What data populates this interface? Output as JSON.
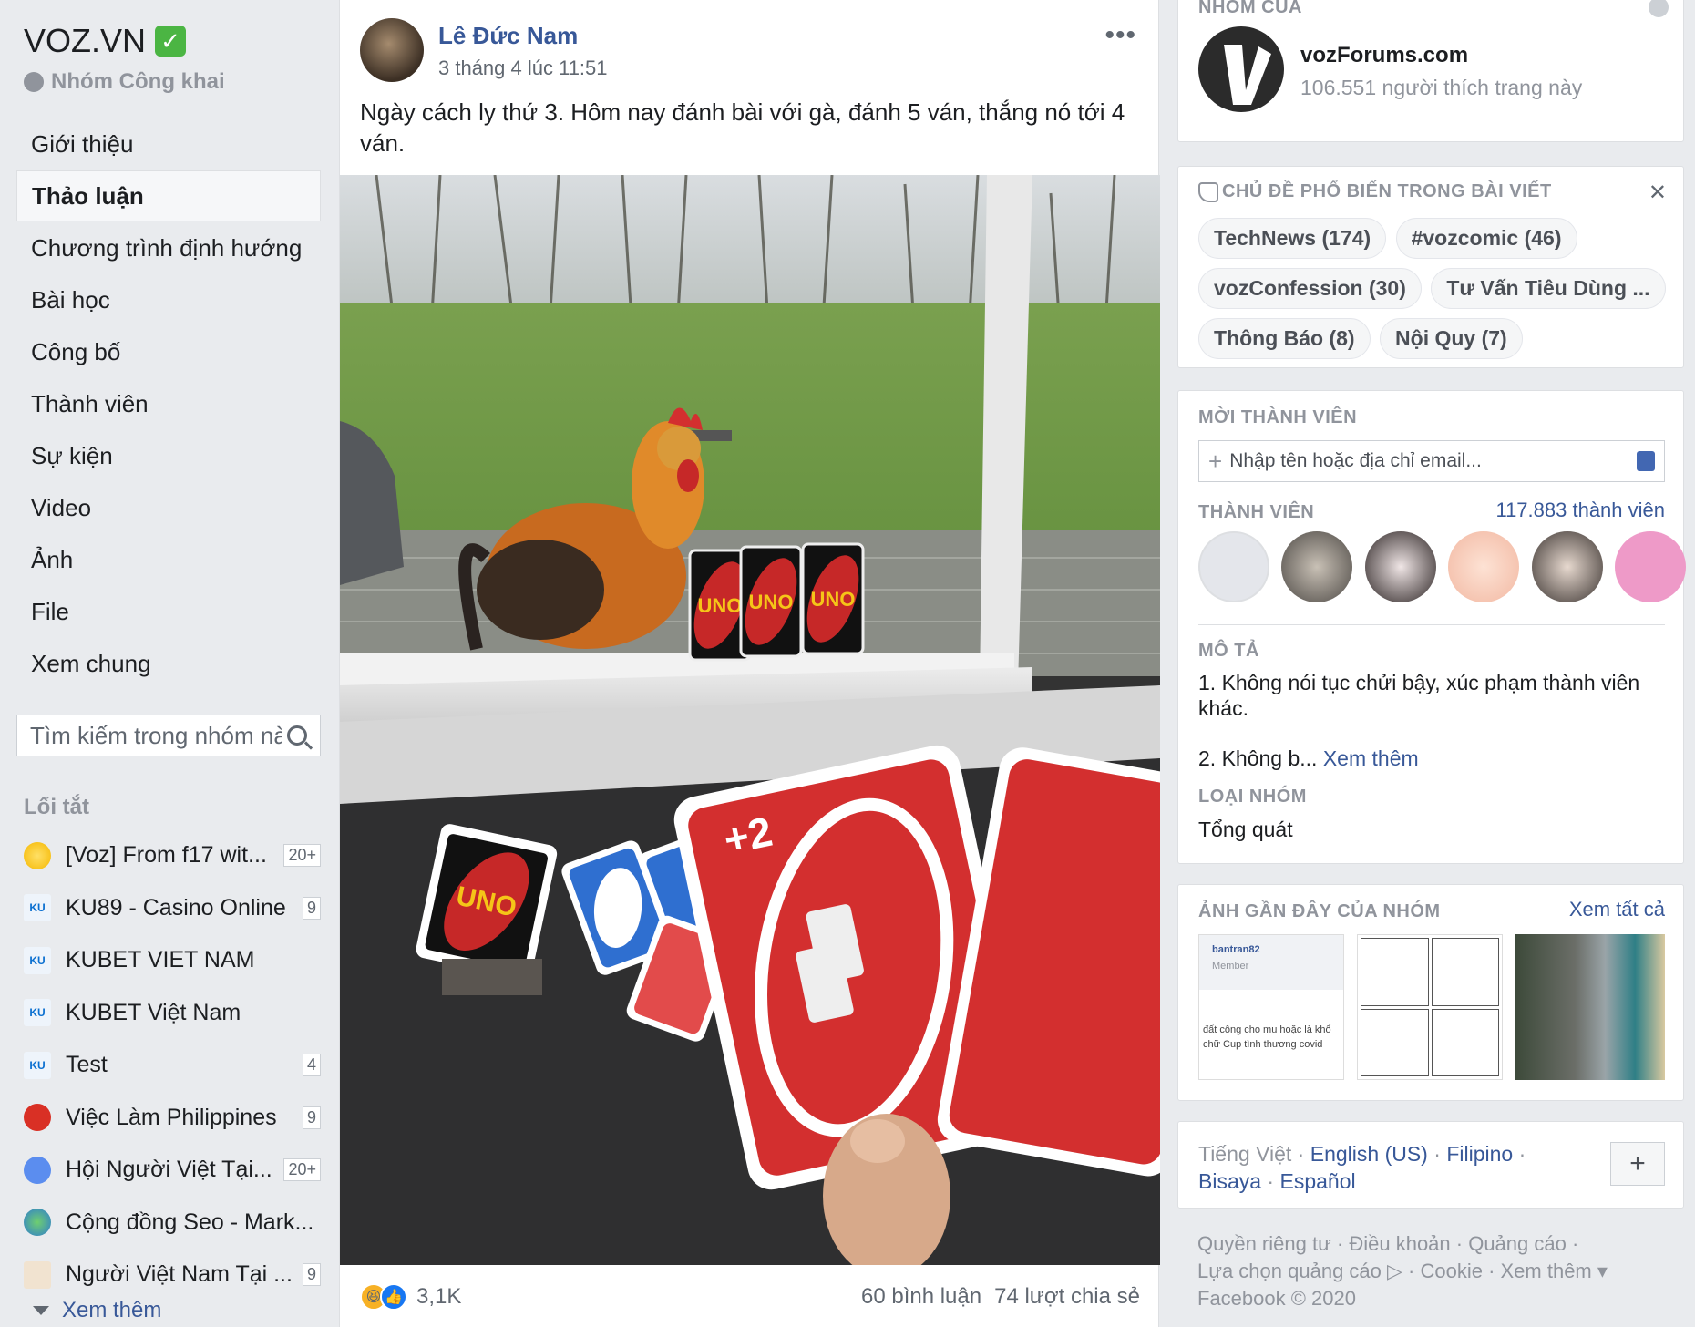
{
  "group": {
    "name": "VOZ.VN",
    "verified_mark": "✓",
    "type": "Nhóm Công khai"
  },
  "nav": [
    {
      "label": "Giới thiệu",
      "active": false
    },
    {
      "label": "Thảo luận",
      "active": true
    },
    {
      "label": "Chương trình định hướng",
      "active": false
    },
    {
      "label": "Bài học",
      "active": false
    },
    {
      "label": "Công bố",
      "active": false
    },
    {
      "label": "Thành viên",
      "active": false
    },
    {
      "label": "Sự kiện",
      "active": false
    },
    {
      "label": "Video",
      "active": false
    },
    {
      "label": "Ảnh",
      "active": false
    },
    {
      "label": "File",
      "active": false
    },
    {
      "label": "Xem chung",
      "active": false
    }
  ],
  "search": {
    "placeholder": "Tìm kiếm trong nhóm này"
  },
  "shortcuts": {
    "title": "Lối tắt",
    "items": [
      {
        "label": "[Voz] From f17 wit...",
        "badge": "20+",
        "icon": "sun-icon"
      },
      {
        "label": "KU89 - Casino Online",
        "badge": "9",
        "icon": "ku-logo-icon"
      },
      {
        "label": "KUBET VIET NAM",
        "badge": "",
        "icon": "ku-logo-icon"
      },
      {
        "label": "KUBET Việt Nam",
        "badge": "",
        "icon": "ku-logo-icon"
      },
      {
        "label": "Test",
        "badge": "4",
        "icon": "ku-logo-icon"
      },
      {
        "label": "Việc Làm Philippines",
        "badge": "9",
        "icon": "red-circle-icon"
      },
      {
        "label": "Hội Người Việt Tại...",
        "badge": "20+",
        "icon": "group-people-icon"
      },
      {
        "label": "Cộng đồng Seo - Mark...",
        "badge": "",
        "icon": "globe-icon"
      },
      {
        "label": "Người Việt Nam Tại ...",
        "badge": "9",
        "icon": "house-icon"
      }
    ],
    "see_more": "Xem thêm"
  },
  "post": {
    "author": "Lê Đức Nam",
    "time": "3 tháng 4 lúc 11:51",
    "more": "•••",
    "text": "Ngày cách ly thứ 3. Hôm nay đánh bài với gà, đánh 5 ván, thắng nó tới 4 ván.",
    "card_text": "UNO",
    "plus_two": "+2",
    "reactions_count": "3,1K",
    "comments": "60 bình luận",
    "shares": "74 lượt chia sẻ"
  },
  "page_card": {
    "heading": "NHÓM CỦA",
    "name": "vozForums.com",
    "likes": "106.551 người thích trang này"
  },
  "topics": {
    "title": "CHỦ ĐỀ PHỔ BIẾN TRONG BÀI VIẾT",
    "close": "✕",
    "items": [
      "TechNews (174)",
      "#vozcomic (46)",
      "vozConfession (30)",
      "Tư Vấn Tiêu Dùng ...",
      "Thông Báo (8)",
      "Nội Quy (7)"
    ]
  },
  "invite": {
    "title": "MỜI THÀNH VIÊN",
    "placeholder": "Nhập tên hoặc địa chỉ email..."
  },
  "members": {
    "title": "THÀNH VIÊN",
    "count": "117.883 thành viên"
  },
  "about": {
    "desc_title": "MÔ TẢ",
    "desc_line1": "1. Không nói tục chửi bậy, xúc phạm thành viên khác.",
    "desc_line2": "2. Không b...",
    "see_more": "Xem thêm",
    "type_title": "LOẠI NHÓM",
    "type_value": "Tổng quát"
  },
  "photos": {
    "title": "ẢNH GẦN ĐÂY CỦA NHÓM",
    "see_all": "Xem tất cả",
    "thumb1_user": "bantran82",
    "thumb1_role": "Member",
    "thumb1_text": "đất công cho mu hoặc là khổ chữ Cup tình thương covid"
  },
  "languages": {
    "current": "Tiếng Việt",
    "others": [
      "English (US)",
      "Filipino",
      "Bisaya",
      "Español"
    ],
    "add": "+"
  },
  "footer": {
    "line1": "Quyền riêng tư · Điều khoản · Quảng cáo ·",
    "line2": "Lựa chọn quảng cáo ▷ · Cookie · Xem thêm ▾",
    "line3": "Facebook © 2020"
  }
}
